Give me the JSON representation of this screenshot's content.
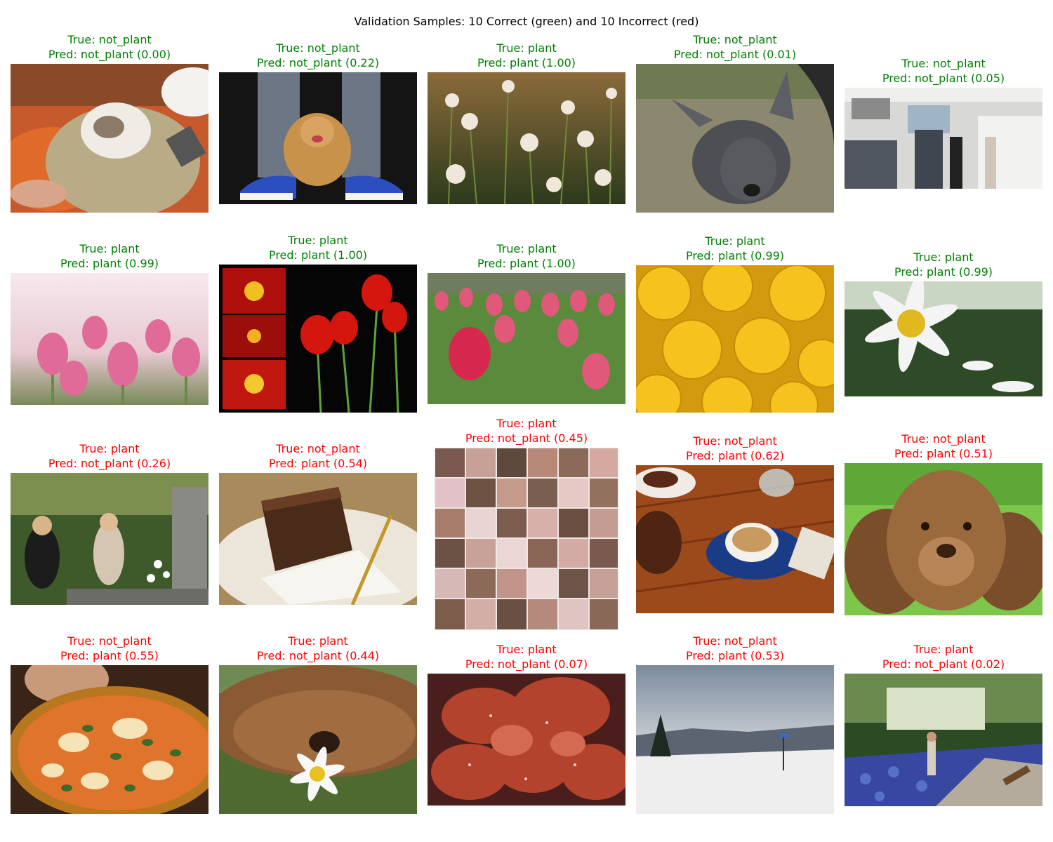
{
  "title": "Validation Samples: 10 Correct (green) and 10 Incorrect (red)",
  "colors": {
    "correct": "#008000",
    "incorrect": "#ff0000"
  },
  "samples": [
    {
      "true_line": "True: not_plant",
      "pred_line": "Pred: not_plant (0.00)",
      "correct": true,
      "image": "cat lying on its back on a lap"
    },
    {
      "true_line": "True: not_plant",
      "pred_line": "Pred: not_plant (0.22)",
      "correct": true,
      "image": "pomeranian dog between legs in sneakers"
    },
    {
      "true_line": "True: plant",
      "pred_line": "Pred: plant (1.00)",
      "correct": true,
      "image": "dandelion seed heads in a meadow"
    },
    {
      "true_line": "True: not_plant",
      "pred_line": "Pred: not_plant (0.01)",
      "correct": true,
      "image": "hairless dog on dirt ground"
    },
    {
      "true_line": "True: not_plant",
      "pred_line": "Pred: not_plant (0.05)",
      "correct": true,
      "image": "kitchen interior with two people"
    },
    {
      "true_line": "True: plant",
      "pred_line": "Pred: plant (0.99)",
      "correct": true,
      "image": "pink tulips against bright sky"
    },
    {
      "true_line": "True: plant",
      "pred_line": "Pred: plant (1.00)",
      "correct": true,
      "image": "red tulips collage on black"
    },
    {
      "true_line": "True: plant",
      "pred_line": "Pred: plant (1.00)",
      "correct": true,
      "image": "field of pink tulips"
    },
    {
      "true_line": "True: plant",
      "pred_line": "Pred: plant (0.99)",
      "correct": true,
      "image": "yellow roses close-up"
    },
    {
      "true_line": "True: plant",
      "pred_line": "Pred: plant (0.99)",
      "correct": true,
      "image": "white daisy with yellow center"
    },
    {
      "true_line": "True: plant",
      "pred_line": "Pred: not_plant (0.26)",
      "correct": false,
      "image": "family by a fountain in a garden"
    },
    {
      "true_line": "True: not_plant",
      "pred_line": "Pred: plant (0.54)",
      "correct": false,
      "image": "slice of chocolate layer cake with fork"
    },
    {
      "true_line": "True: plant",
      "pred_line": "Pred: not_plant (0.45)",
      "correct": false,
      "image": "grid collage of vintage tea items"
    },
    {
      "true_line": "True: not_plant",
      "pred_line": "Pred: plant (0.62)",
      "correct": false,
      "image": "latte cup on wooden table"
    },
    {
      "true_line": "True: not_plant",
      "pred_line": "Pred: plant (0.51)",
      "correct": false,
      "image": "brown spaniel dog on grass"
    },
    {
      "true_line": "True: not_plant",
      "pred_line": "Pred: plant (0.55)",
      "correct": false,
      "image": "margherita pizza with basil"
    },
    {
      "true_line": "True: plant",
      "pred_line": "Pred: not_plant (0.44)",
      "correct": false,
      "image": "shaggy dog sniffing a daisy"
    },
    {
      "true_line": "True: plant",
      "pred_line": "Pred: not_plant (0.07)",
      "correct": false,
      "image": "dark red flower petals with water drops"
    },
    {
      "true_line": "True: not_plant",
      "pred_line": "Pred: plant (0.53)",
      "correct": false,
      "image": "snowy mountain overlook under clouds"
    },
    {
      "true_line": "True: plant",
      "pred_line": "Pred: not_plant (0.02)",
      "correct": false,
      "image": "garden path with bluebells and people"
    }
  ]
}
